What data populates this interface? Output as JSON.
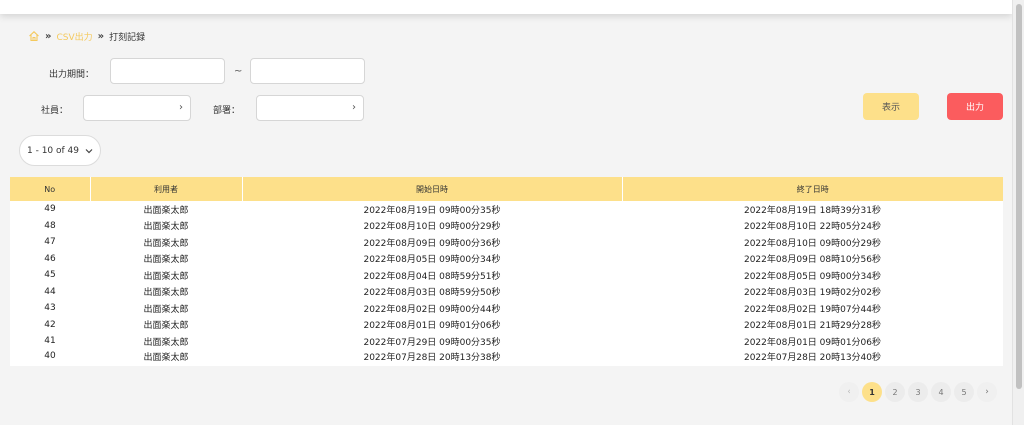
{
  "breadcrumb": {
    "link": "CSV出力",
    "current": "打刻記録",
    "separator": "»"
  },
  "filters": {
    "period_label": "出力期間：",
    "period_tilde": "~",
    "employee_label": "社員：",
    "department_label": "部署："
  },
  "buttons": {
    "show": "表示",
    "export": "出力"
  },
  "per_page": {
    "text": "1 - 10 of 49"
  },
  "table": {
    "headers": [
      "No",
      "利用者",
      "開始日時",
      "終了日時"
    ],
    "rows": [
      [
        "49",
        "出面楽太郎",
        "2022年08月19日 09時00分35秒",
        "2022年08月19日 18時39分31秒"
      ],
      [
        "48",
        "出面楽太郎",
        "2022年08月10日 09時00分29秒",
        "2022年08月10日 22時05分24秒"
      ],
      [
        "47",
        "出面楽太郎",
        "2022年08月09日 09時00分36秒",
        "2022年08月10日 09時00分29秒"
      ],
      [
        "46",
        "出面楽太郎",
        "2022年08月05日 09時00分34秒",
        "2022年08月09日 08時10分56秒"
      ],
      [
        "45",
        "出面楽太郎",
        "2022年08月04日 08時59分51秒",
        "2022年08月05日 09時00分34秒"
      ],
      [
        "44",
        "出面楽太郎",
        "2022年08月03日 08時59分50秒",
        "2022年08月03日 19時02分02秒"
      ],
      [
        "43",
        "出面楽太郎",
        "2022年08月02日 09時00分44秒",
        "2022年08月02日 19時07分44秒"
      ],
      [
        "42",
        "出面楽太郎",
        "2022年08月01日 09時01分06秒",
        "2022年08月01日 21時29分28秒"
      ],
      [
        "41",
        "出面楽太郎",
        "2022年07月29日 09時00分35秒",
        "2022年08月01日 09時01分06秒"
      ],
      [
        "40",
        "出面楽太郎",
        "2022年07月28日 20時13分38秒",
        "2022年07月28日 20時13分40秒"
      ]
    ]
  },
  "pagination": {
    "prev": "‹",
    "pages": [
      "1",
      "2",
      "3",
      "4",
      "5"
    ],
    "active_page": "1",
    "next": "›"
  },
  "icons": {
    "home": "home-icon",
    "chevron": "chevron-right-icon",
    "dropdown": "chevron-down-icon"
  },
  "colors": {
    "accent_yellow": "#fde08a",
    "export_red": "#fb5c5e",
    "breadcrumb_link": "#f4c95d"
  }
}
